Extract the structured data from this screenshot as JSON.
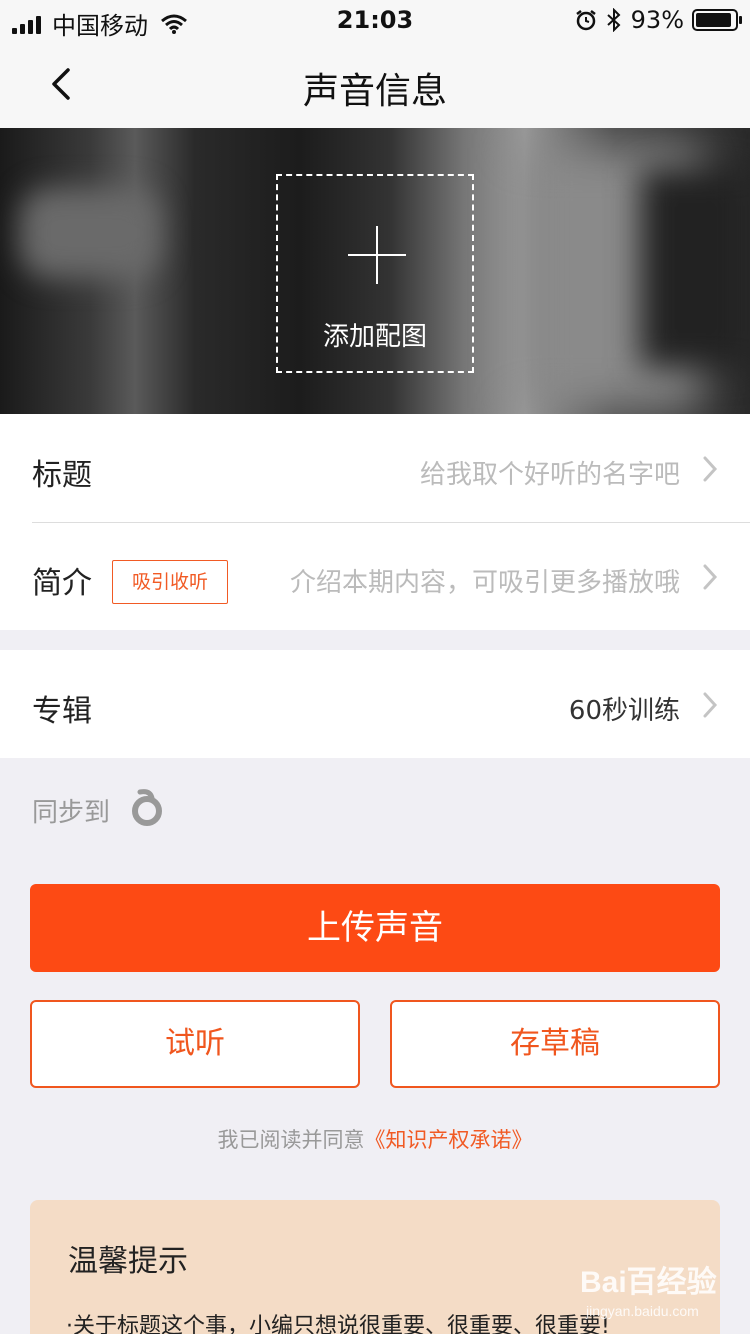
{
  "status_bar": {
    "carrier": "中国移动",
    "time": "21:03",
    "battery": "93%",
    "battery_level": 0.93,
    "icons": [
      "signal-icon",
      "wifi-icon",
      "alarm-icon",
      "bluetooth-icon",
      "battery-icon"
    ]
  },
  "nav": {
    "title": "声音信息",
    "back_icon": "chevron-left-icon"
  },
  "cover": {
    "add_label": "添加配图",
    "add_icon": "plus-icon"
  },
  "form": {
    "title_label": "标题",
    "title_placeholder": "给我取个好听的名字吧",
    "intro_label": "简介",
    "intro_tag": "吸引收听",
    "intro_placeholder": "介绍本期内容，可吸引更多播放哦",
    "album_label": "专辑",
    "album_value": "60秒训练"
  },
  "sync": {
    "label": "同步到",
    "icon": "sync-platform-icon"
  },
  "actions": {
    "upload": "上传声音",
    "preview": "试听",
    "draft": "存草稿"
  },
  "agreement": {
    "prefix": "我已阅读并同意",
    "link": "《知识产权承诺》"
  },
  "tips": {
    "title": "温馨提示",
    "text": "·关于标题这个事，小编只想说很重要、很重要、很重要!"
  },
  "watermark": {
    "brand": "Bai百经验",
    "url": "jingyan.baidu.com"
  },
  "colors": {
    "accent": "#fd4a14",
    "tips_bg": "#f4dcc6",
    "page_bg": "#f0eff4"
  }
}
